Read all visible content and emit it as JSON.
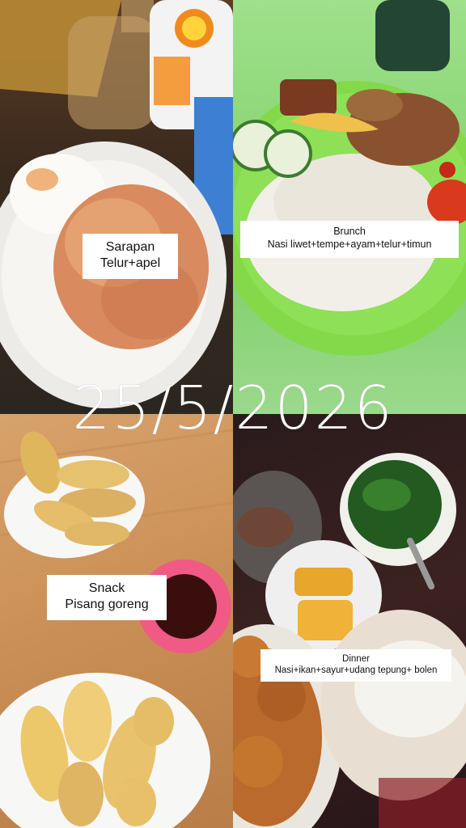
{
  "date": "25/5/2026",
  "meals": {
    "breakfast": {
      "title": "Sarapan",
      "items": "Telur+apel"
    },
    "brunch": {
      "title": "Brunch",
      "items": "Nasi liwet+tempe+ayam+telur+timun"
    },
    "snack": {
      "title": "Snack",
      "items": "Pisang goreng"
    },
    "dinner": {
      "title": "Dinner",
      "items": "Nasi+ikan+sayur+udang tepung+ bolen"
    }
  }
}
